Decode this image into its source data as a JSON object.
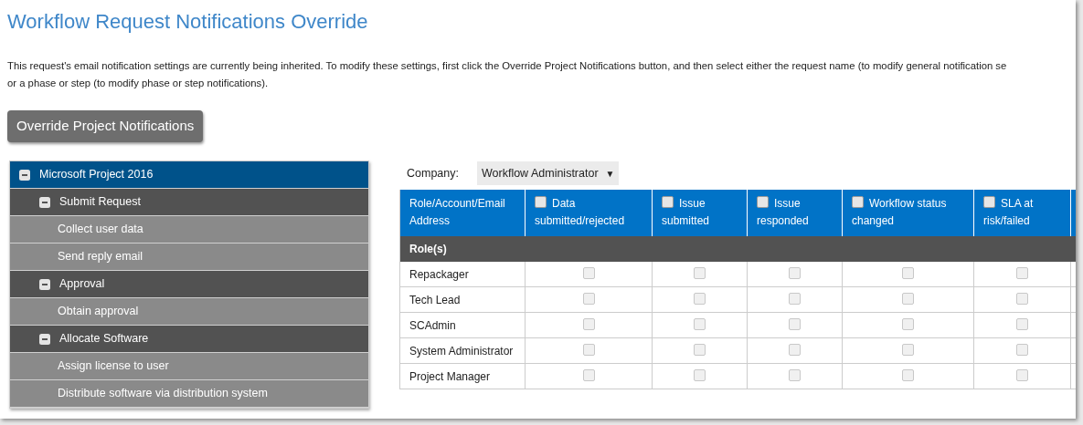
{
  "title": "Workflow Request Notifications Override",
  "description": [
    "This request's email notification settings are currently being inherited. To modify these settings, first click the Override Project Notifications button, and then select either the request name (to modify general notification se",
    "or a phase or step (to modify phase or step notifications)."
  ],
  "override_button": "Override Project Notifications",
  "tree": [
    {
      "label": "Microsoft Project 2016",
      "expanded": true,
      "selected": true,
      "children": [
        {
          "label": "Submit Request",
          "expanded": true,
          "selected": false,
          "children": [
            {
              "label": "Collect user data",
              "selected": false
            },
            {
              "label": "Send reply email",
              "selected": false
            }
          ]
        },
        {
          "label": "Approval",
          "expanded": true,
          "selected": false,
          "children": [
            {
              "label": "Obtain approval",
              "selected": false
            }
          ]
        },
        {
          "label": "Allocate Software",
          "expanded": true,
          "selected": false,
          "children": [
            {
              "label": "Assign license to user",
              "selected": false
            },
            {
              "label": "Distribute software via distribution system",
              "selected": false
            }
          ]
        }
      ]
    }
  ],
  "company": {
    "label": "Company:",
    "value": "Workflow Administrator",
    "caret": "▼"
  },
  "table": {
    "first_column": "Role/Account/Email Address",
    "columns": [
      {
        "label": "Data submitted/rejected",
        "checked": false
      },
      {
        "label": "Issue submitted",
        "checked": false
      },
      {
        "label": "Issue responded",
        "checked": false
      },
      {
        "label": "Workflow status changed",
        "checked": false
      },
      {
        "label": "SLA at risk/failed",
        "checked": false
      }
    ],
    "group": "Role(s)",
    "rows": [
      {
        "name": "Repackager",
        "disabled": true,
        "checks": [
          false,
          false,
          false,
          false,
          false
        ]
      },
      {
        "name": "Tech Lead",
        "disabled": true,
        "checks": [
          false,
          false,
          false,
          false,
          false
        ]
      },
      {
        "name": "SCAdmin",
        "disabled": true,
        "checks": [
          false,
          false,
          false,
          false,
          false
        ]
      },
      {
        "name": "System Administrator",
        "disabled": true,
        "checks": [
          false,
          false,
          false,
          false,
          false
        ]
      },
      {
        "name": "Project Manager",
        "disabled": true,
        "checks": [
          false,
          false,
          false,
          false,
          false
        ]
      }
    ]
  }
}
